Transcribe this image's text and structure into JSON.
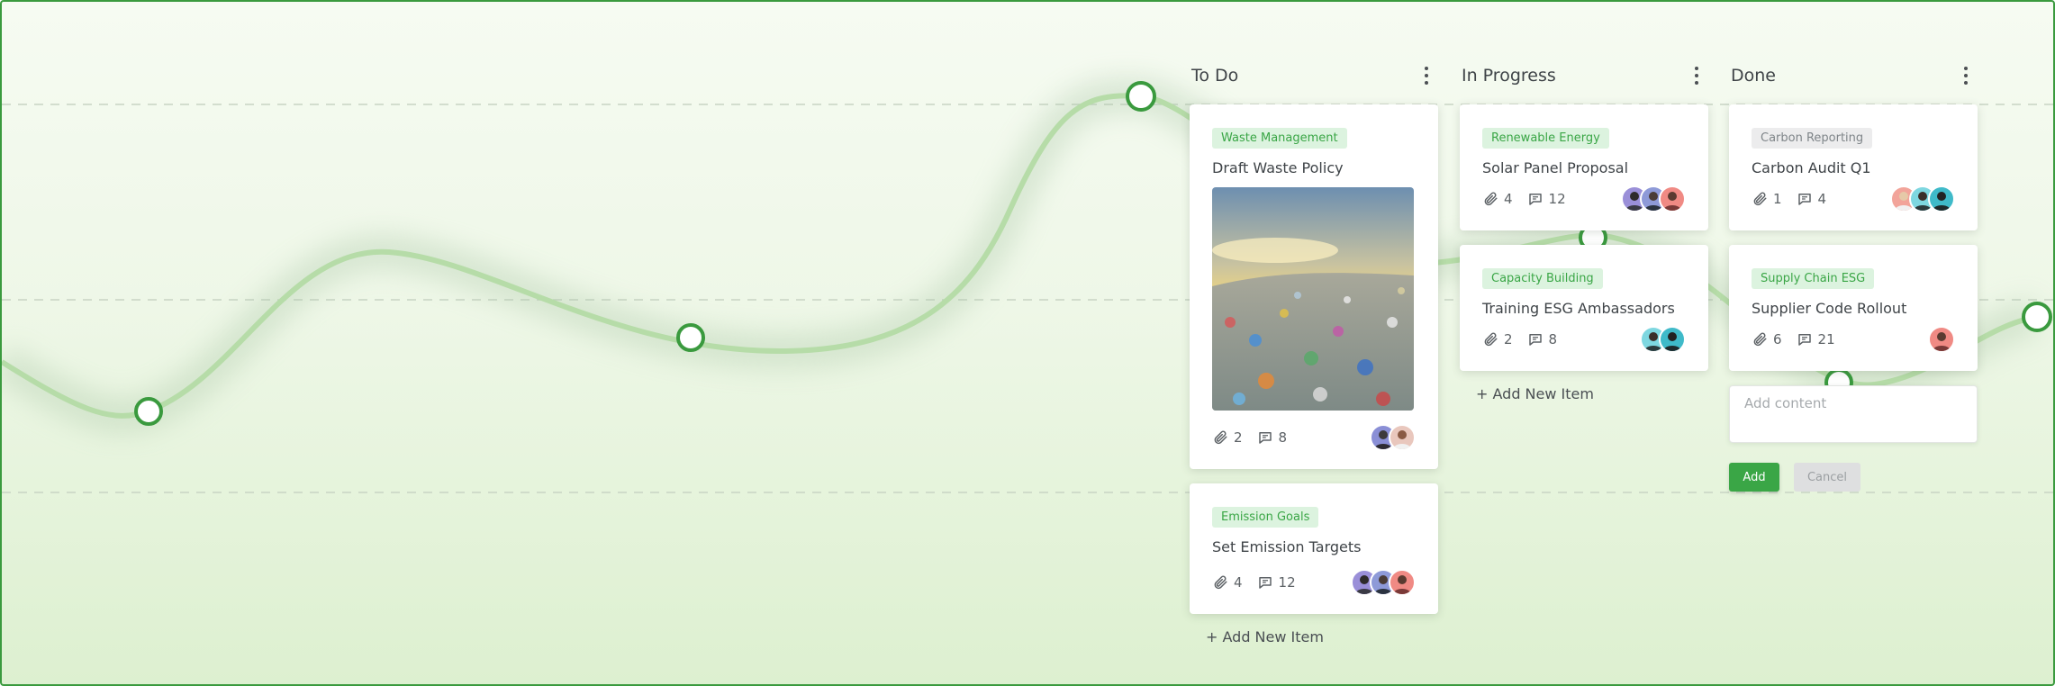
{
  "board": {
    "columns": [
      {
        "title": "To Do",
        "cards": [
          {
            "badge": "Waste Management",
            "badge_style": "green",
            "title": "Draft Waste Policy",
            "has_image": true,
            "attachments": "2",
            "comments": "8",
            "avatars": [
              "avatar-a",
              "avatar-b"
            ]
          },
          {
            "badge": "Emission Goals",
            "badge_style": "green",
            "title": "Set Emission Targets",
            "has_image": false,
            "attachments": "4",
            "comments": "12",
            "avatars": [
              "avatar-c",
              "avatar-d",
              "avatar-e"
            ]
          }
        ],
        "add_label": "+ Add New Item"
      },
      {
        "title": "In Progress",
        "cards": [
          {
            "badge": "Renewable Energy",
            "badge_style": "green",
            "title": "Solar Panel Proposal",
            "has_image": false,
            "attachments": "4",
            "comments": "12",
            "avatars": [
              "avatar-c",
              "avatar-d",
              "avatar-e"
            ]
          },
          {
            "badge": "Capacity Building",
            "badge_style": "green",
            "title": "Training ESG Ambassadors",
            "has_image": false,
            "attachments": "2",
            "comments": "8",
            "avatars": [
              "avatar-f",
              "avatar-g"
            ]
          }
        ],
        "add_label": "+ Add New Item"
      },
      {
        "title": "Done",
        "cards": [
          {
            "badge": "Carbon Reporting",
            "badge_style": "gray",
            "title": "Carbon Audit Q1",
            "has_image": false,
            "attachments": "1",
            "comments": "4",
            "avatars": [
              "avatar-h",
              "avatar-f",
              "avatar-g"
            ]
          },
          {
            "badge": "Supply Chain ESG",
            "badge_style": "green",
            "title": "Supplier Code Rollout",
            "has_image": false,
            "attachments": "6",
            "comments": "21",
            "avatars": [
              "avatar-e"
            ]
          }
        ],
        "add_placeholder": "Add content",
        "add_button": "Add",
        "cancel_button": "Cancel"
      }
    ]
  },
  "icons": {
    "menu": "more-vertical-icon",
    "attachment": "paperclip-icon",
    "comment": "message-square-icon"
  },
  "colors": {
    "accent": "#3aa646",
    "frame": "#3a9a3e",
    "curve": "#b6dca8"
  }
}
